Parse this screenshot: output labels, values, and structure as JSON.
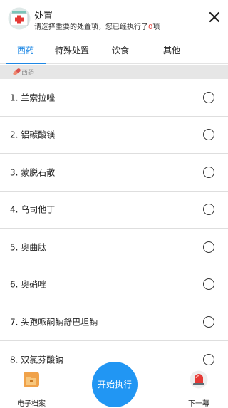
{
  "header": {
    "title": "处置",
    "subtitle_prefix": "请选择重要的处置项，您已经执行了",
    "executed_count": "0",
    "subtitle_suffix": "项",
    "icon": "medical-kit-icon",
    "close_icon": "close-icon"
  },
  "tabs": [
    {
      "label": "西药",
      "active": true
    },
    {
      "label": "特殊处置",
      "active": false
    },
    {
      "label": "饮食",
      "active": false
    },
    {
      "label": "其他",
      "active": false
    }
  ],
  "section": {
    "label": "西药",
    "icon": "pill-icon"
  },
  "items": [
    {
      "label": "1. 兰索拉唑",
      "selected": false
    },
    {
      "label": "2. 铝碳酸镁",
      "selected": false
    },
    {
      "label": "3. 蒙脱石散",
      "selected": false
    },
    {
      "label": "4. 乌司他丁",
      "selected": false
    },
    {
      "label": "5. 奥曲肽",
      "selected": false
    },
    {
      "label": "6. 奥硝唑",
      "selected": false
    },
    {
      "label": "7. 头孢哌酮钠舒巴坦钠",
      "selected": false
    },
    {
      "label": "8. 双氯芬酸钠",
      "selected": false
    }
  ],
  "bottom": {
    "left_label": "电子档案",
    "left_icon": "folder-icon",
    "center_label": "开始执行",
    "right_label": "下一幕",
    "right_icon": "alarm-light-icon"
  },
  "colors": {
    "accent": "#1e88e5",
    "start_button": "#2196f3",
    "count_red": "#e53935",
    "section_bg": "#e6e6e6"
  }
}
